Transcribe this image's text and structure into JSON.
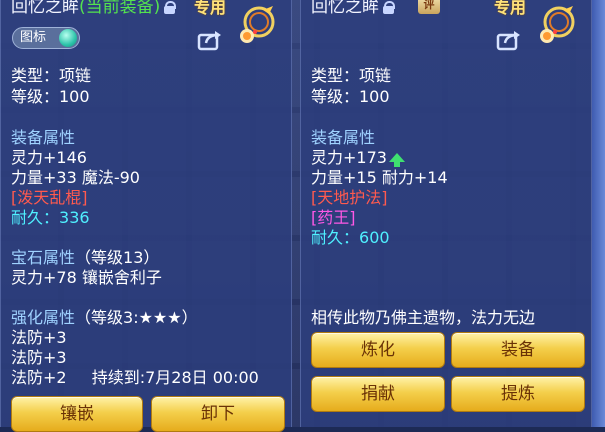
{
  "left": {
    "title_name": "回忆之眸",
    "title_status": "(当前装备)",
    "exclusive": "专用",
    "toggle_label": "图标",
    "type": "类型：项链",
    "level": "等级：100",
    "equip_attr_header": "装备属性",
    "attr_1": "灵力+146",
    "attr_2": "力量+33 魔法-90",
    "skill": "[泼天乱棍]",
    "durability_label": "耐久：",
    "durability_value": "336",
    "gem_header": "宝石属性",
    "gem_level": "（等级13）",
    "gem_line": "灵力+78 镶嵌舍利子",
    "enhance_header": "强化属性",
    "enhance_level": "（等级3:★★★）",
    "enhance_1": "法防+3",
    "enhance_2": "法防+3",
    "enhance_3": "法防+2",
    "enhance_3_duration": "持续到:7月28日 00:00",
    "btn_inlay": "镶嵌",
    "btn_unequip": "卸下"
  },
  "right": {
    "title_name": "回忆之眸",
    "seal_label": "评",
    "exclusive": "专用",
    "type": "类型：项链",
    "level": "等级：100",
    "equip_attr_header": "装备属性",
    "attr_1": "灵力+173",
    "attr_2": "力量+15 耐力+14",
    "skill": "[天地护法]",
    "special": "[药王]",
    "durability_label": "耐久：",
    "durability_value": "600",
    "description": "相传此物乃佛主遗物，法力无边",
    "btn_refine": "炼化",
    "btn_equip": "装备",
    "btn_donate": "捐献",
    "btn_extract": "提炼"
  },
  "colors": {
    "panel_bg": "#2c3e7d",
    "section_header": "#9fd2ff",
    "skill_red": "#ff5a4e",
    "durability_cyan": "#4ff0ff",
    "special_magenta": "#ff58e6",
    "current_equip_green": "#54e34e",
    "button_gold": "#f4cf4b"
  },
  "icons": {
    "lock": "lock-icon",
    "share": "share-icon",
    "item": "necklace-item-icon",
    "stat_up": "arrow-up-icon"
  }
}
